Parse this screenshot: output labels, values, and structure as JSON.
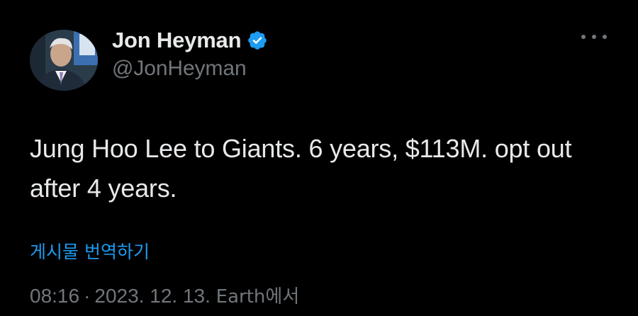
{
  "author": {
    "display_name": "Jon Heyman",
    "handle": "@JonHeyman",
    "verified": true,
    "avatar_icon": "profile-photo"
  },
  "menu": {
    "icon": "more-horizontal-icon"
  },
  "tweet": {
    "text_line1": "Jung Hoo Lee to Giants. 6 years, $113M.  opt out",
    "text_line2": "after 4 years."
  },
  "translate": {
    "label": "게시물 번역하기"
  },
  "meta": {
    "time": "08:16",
    "separator": "·",
    "date": "2023. 12. 13.",
    "source": "Earth에서"
  },
  "colors": {
    "background": "#000000",
    "text": "#e7e9ea",
    "secondary": "#71767b",
    "accent": "#1d9bf0"
  }
}
